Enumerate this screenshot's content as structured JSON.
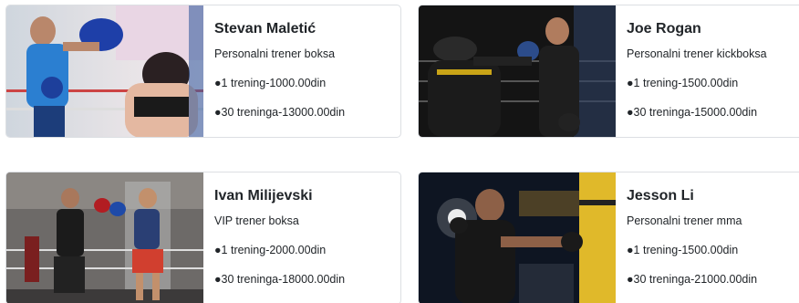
{
  "trainers": [
    {
      "name": "Stevan Maletić",
      "role": "Personalni trener boksa",
      "price_single": "●1 trening-1000.00din",
      "price_package": "●30 treninga-13000.00din",
      "image": "boxer-blue-tank-sparring-photo"
    },
    {
      "name": "Joe Rogan",
      "role": "Personalni trener kickboksa",
      "price_single": "●1 trening-1500.00din",
      "price_package": "●30 treninga-15000.00din",
      "image": "kickboxing-pads-training-photo"
    },
    {
      "name": "Ivan Milijevski",
      "role": "VIP trener boksa",
      "price_single": "●1 trening-2000.00din",
      "price_package": "●30 treninga-18000.00din",
      "image": "boxing-ring-sparring-photo"
    },
    {
      "name": "Jesson Li",
      "role": "Personalni trener mma",
      "price_single": "●1 trening-1500.00din",
      "price_package": "●30 treninga-21000.00din",
      "image": "punching-bag-gym-photo"
    }
  ]
}
